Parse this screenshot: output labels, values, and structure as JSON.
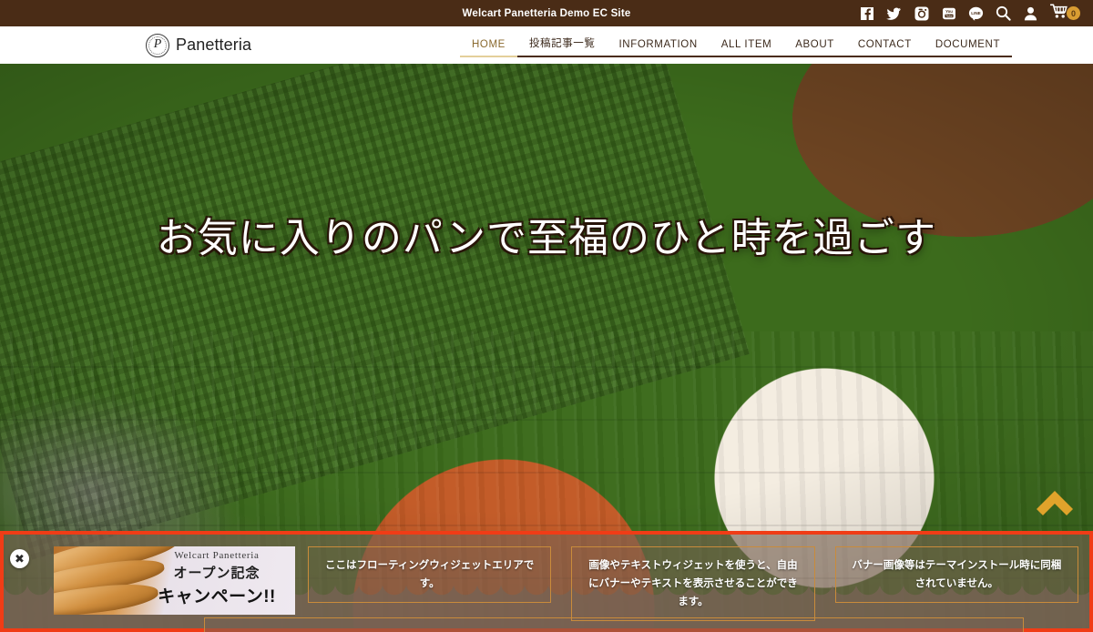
{
  "topbar": {
    "title": "Welcart Panetteria Demo EC Site",
    "icons": [
      {
        "name": "facebook-icon",
        "label": "Facebook"
      },
      {
        "name": "twitter-icon",
        "label": "Twitter"
      },
      {
        "name": "instagram-icon",
        "label": "Instagram"
      },
      {
        "name": "youtube-icon",
        "label": "YouTube"
      },
      {
        "name": "line-icon",
        "label": "LINE"
      },
      {
        "name": "search-icon",
        "label": "Search"
      },
      {
        "name": "user-icon",
        "label": "Account"
      }
    ],
    "cart": {
      "name": "cart-icon",
      "label": "Cart",
      "count": "0",
      "badge_color": "#d99d32"
    }
  },
  "header": {
    "logo_mark": "P",
    "logo_text": "Panetteria",
    "nav": [
      {
        "label": "HOME",
        "active": true
      },
      {
        "label": "投稿記事一覧",
        "active": false
      },
      {
        "label": "INFORMATION",
        "active": false
      },
      {
        "label": "ALL ITEM",
        "active": false
      },
      {
        "label": "ABOUT",
        "active": false
      },
      {
        "label": "CONTACT",
        "active": false
      },
      {
        "label": "DOCUMENT",
        "active": false
      }
    ],
    "active_underline_color": "#e4cf9a",
    "underline_color": "#4a2c16"
  },
  "hero": {
    "headline": "お気に入りのパンで至福のひと時を過ごす",
    "scroll_top_label": "ページトップへ",
    "scroll_top_color": "#e0a32b"
  },
  "floating_widget_area": {
    "highlight_color": "#f03c16",
    "close_label": "✖",
    "banner": {
      "line1": "Welcart Panetteria",
      "line2": "オープン記念",
      "line3": "キャンペーン!!"
    },
    "widgets": [
      {
        "text": "ここはフローティングウィジェットエリアです。"
      },
      {
        "text": "画像やテキストウィジェットを使うと、自由にバナーやテキストを表示させることができます。"
      },
      {
        "text": "バナー画像等はテーマインストール時に同梱されていません。"
      }
    ],
    "border_color": "#c98b3b"
  },
  "colors": {
    "topbar_bg": "#4a2c16",
    "accent_gold": "#d99d32",
    "nav_text": "#3c2a1c"
  }
}
